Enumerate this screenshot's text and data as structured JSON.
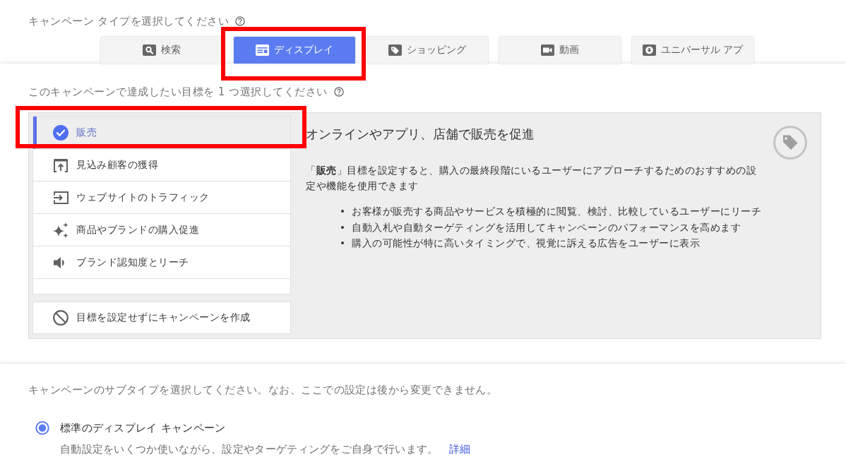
{
  "campaign_type": {
    "heading": "キャンペーン タイプを選択してください",
    "tabs": [
      {
        "label": "検索",
        "selected": false,
        "highlighted": false
      },
      {
        "label": "ディスプレイ",
        "selected": true,
        "highlighted": true
      },
      {
        "label": "ショッピング",
        "selected": false,
        "highlighted": false
      },
      {
        "label": "動画",
        "selected": false,
        "highlighted": false
      },
      {
        "label": "ユニバーサル アプ",
        "selected": false,
        "highlighted": false
      }
    ]
  },
  "goal": {
    "heading": "このキャンペーンで達成したい目標を 1 つ選択してください",
    "options": [
      {
        "label": "販売",
        "selected": true,
        "highlighted": true
      },
      {
        "label": "見込み顧客の獲得",
        "selected": false,
        "highlighted": false
      },
      {
        "label": "ウェブサイトのトラフィック",
        "selected": false,
        "highlighted": false
      },
      {
        "label": "商品やブランドの購入促進",
        "selected": false,
        "highlighted": false
      },
      {
        "label": "ブランド認知度とリーチ",
        "selected": false,
        "highlighted": false
      }
    ],
    "no_goal_option": {
      "label": "目標を設定せずにキャンペーンを作成"
    },
    "detail": {
      "title": "オンラインやアプリ、店舗で販売を促進",
      "description": "「**販売**」目標を設定すると、購入の最終段階にいるユーザーにアプローチするためのおすすめの設定や機能を使用できます",
      "bullets": [
        "お客様が販売する商品やサービスを積極的に閲覧、検討、比較しているユーザーにリーチ",
        "自動入札や自動ターゲティングを活用してキャンペーンのパフォーマンスを高めます",
        "購入の可能性が特に高いタイミングで、視覚に訴える広告をユーザーに表示"
      ]
    }
  },
  "subtype": {
    "heading": "キャンペーンのサブタイプを選択してください。なお、ここでの設定は後から変更できません。",
    "options": [
      {
        "label": "標準のディスプレイ キャンペーン",
        "selected": true,
        "description": "自動設定をいくつか使いながら、設定やターゲティングをご自身で行います。",
        "link": "詳細"
      }
    ]
  }
}
